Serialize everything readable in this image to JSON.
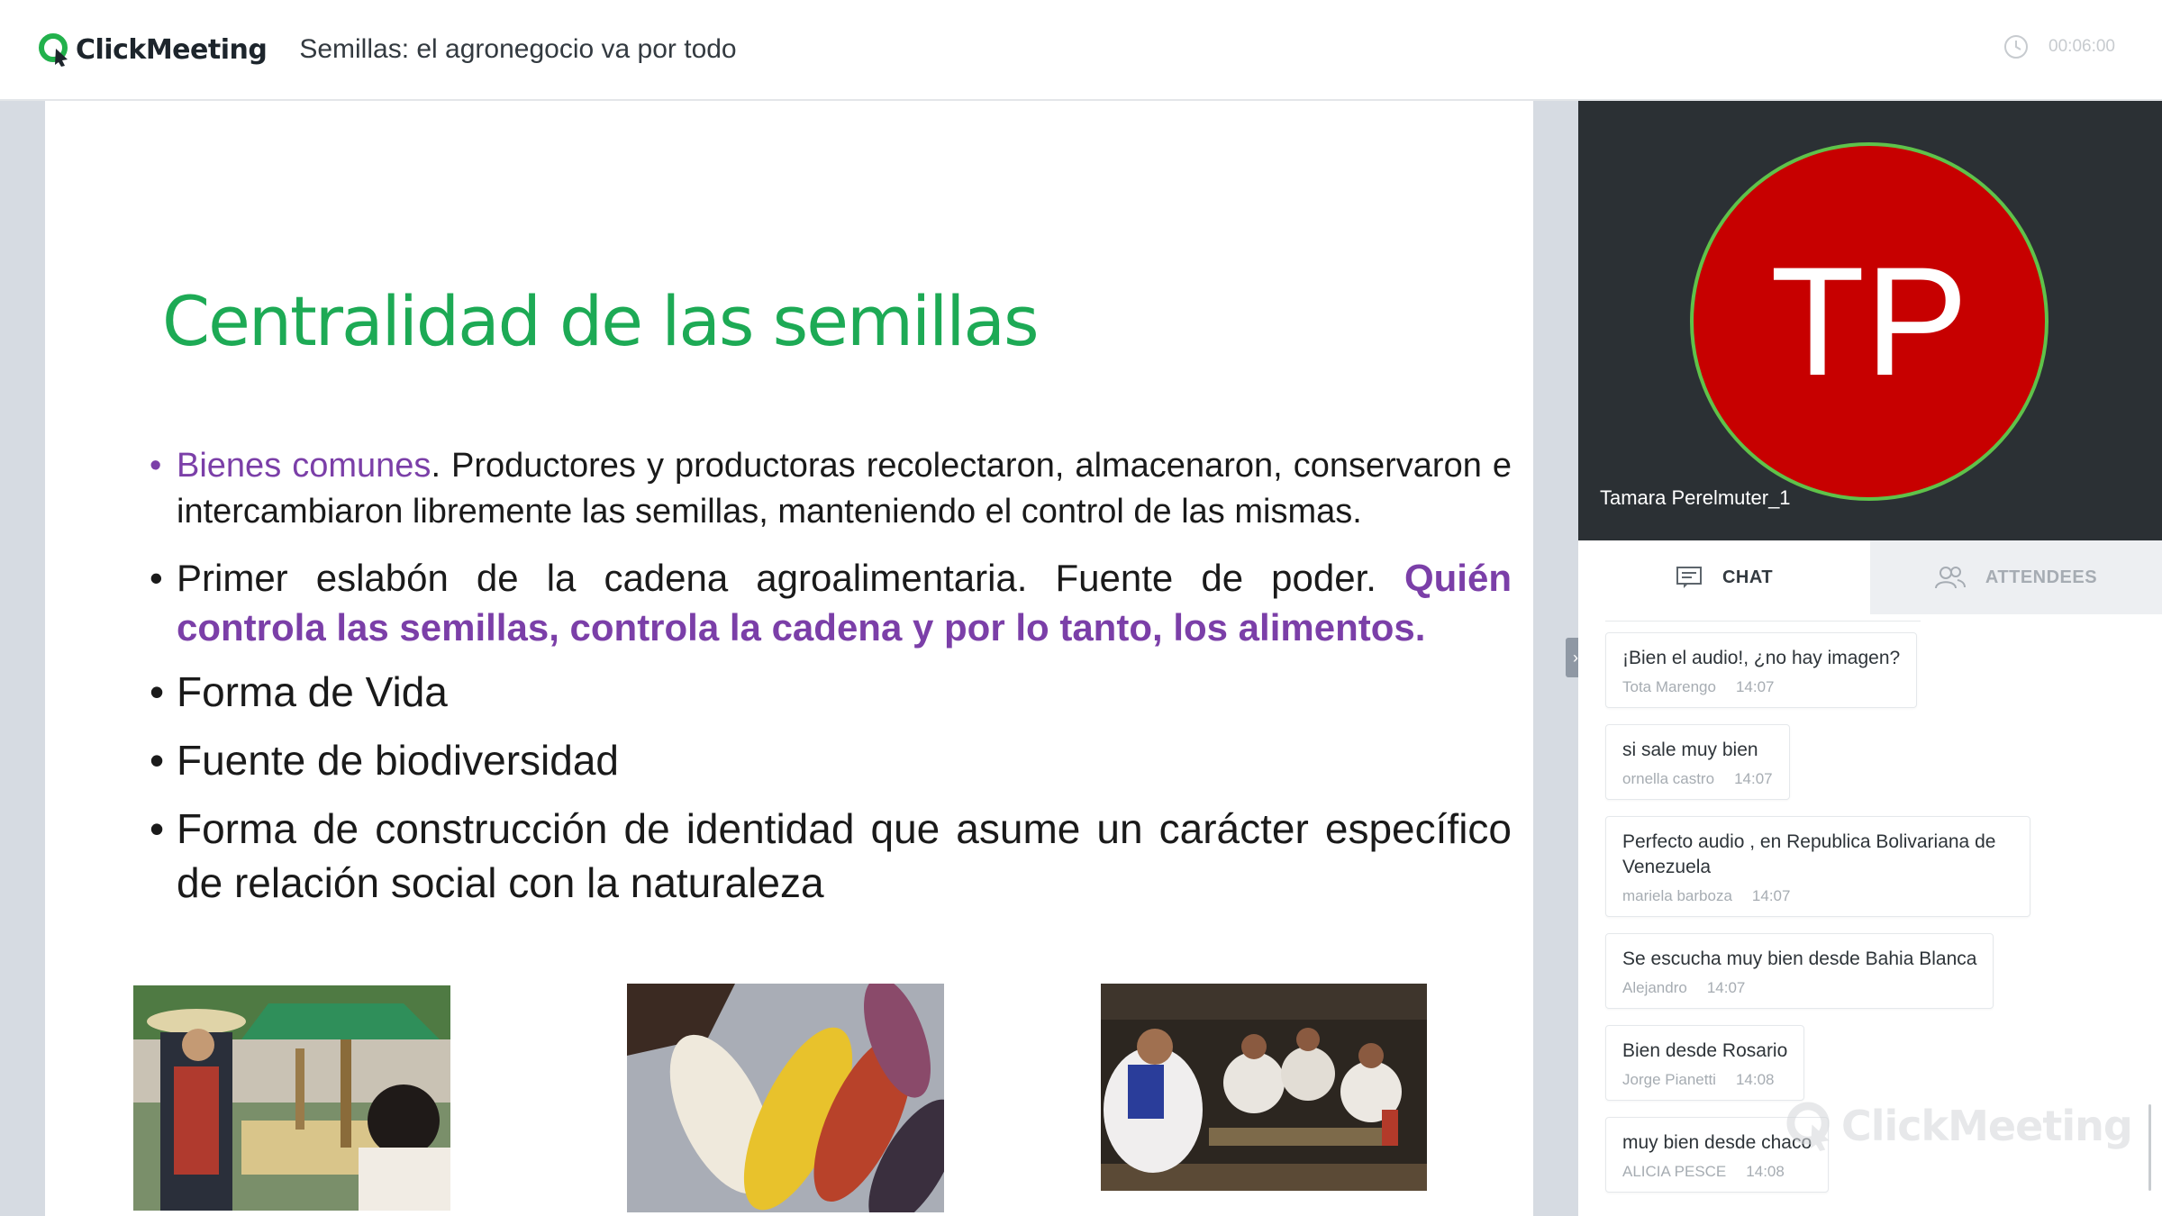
{
  "app": {
    "logo_text": "ClickMeeting",
    "meeting_title": "Semillas: el agronegocio va por todo",
    "timer": "00:06:00",
    "colors": {
      "brand_green": "#1daa55",
      "avatar_red": "#c70000",
      "accent_purple": "#7b3fa8"
    }
  },
  "slide": {
    "title": "Centralidad de las semillas",
    "bullet1_head": "Bienes comunes",
    "bullet1_rest": ". Productores y productoras recolectaron, almacenaron, conservaron e intercambiaron libremente las semillas, manteniendo el control de las mismas.",
    "bullet2_plain": "Primer eslabón de la cadena agroalimentaria. Fuente de poder. ",
    "bullet2_bold": "Quién controla las semillas, controla la cadena y por lo tanto, los alimentos.",
    "bullet3": "Forma de Vida",
    "bullet4": "Fuente de biodiversidad",
    "bullet5": "Forma de construcción de identidad que asume un carácter específico de relación social con la naturaleza"
  },
  "presenter": {
    "initials": "TP",
    "name": "Tamara Perelmuter_1"
  },
  "tabs": {
    "chat": "CHAT",
    "attendees": "ATTENDEES",
    "chat_icon": "chat-icon",
    "attendees_icon": "attendees-icon"
  },
  "chat": {
    "messages": [
      {
        "text": "¡Bien el audio!, ¿no hay imagen?",
        "author": "Tota Marengo",
        "time": "14:07"
      },
      {
        "text": "si sale muy bien",
        "author": "ornella castro",
        "time": "14:07"
      },
      {
        "text": "Perfecto audio , en Republica Bolivariana de Venezuela",
        "author": "mariela barboza",
        "time": "14:07"
      },
      {
        "text": "Se escucha muy bien desde Bahia Blanca",
        "author": "Alejandro",
        "time": "14:07"
      },
      {
        "text": "Bien desde Rosario",
        "author": "Jorge Pianetti",
        "time": "14:08"
      },
      {
        "text": "muy bien desde chaco",
        "author": "ALICIA PESCE",
        "time": "14:08"
      }
    ]
  },
  "watermark": {
    "text": "ClickMeeting"
  }
}
